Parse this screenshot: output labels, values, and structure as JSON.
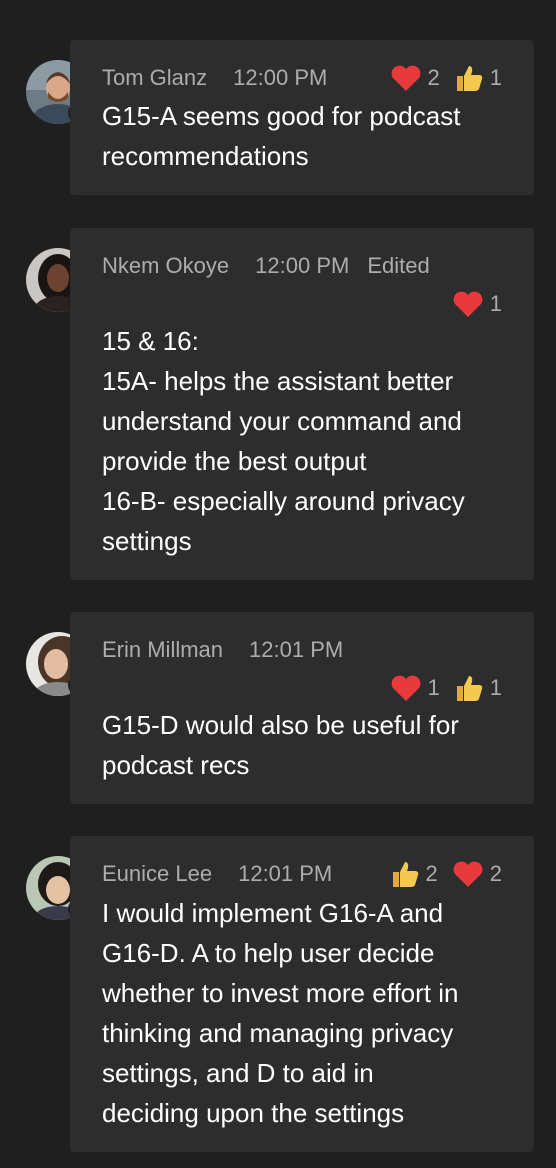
{
  "messages": [
    {
      "author": "Tom Glanz",
      "time": "12:00 PM",
      "edited": "",
      "status": "offline",
      "reactions": [
        {
          "icon": "heart-icon",
          "count": "2"
        },
        {
          "icon": "like-icon",
          "count": "1"
        }
      ],
      "lines": [
        "G15-A seems good for podcast",
        "recommendations"
      ]
    },
    {
      "author": "Nkem Okoye",
      "time": "12:00 PM",
      "edited": "Edited",
      "status": "offline",
      "reactions": [
        {
          "icon": "heart-icon",
          "count": "1"
        }
      ],
      "lines": [
        "15 & 16:",
        "15A- helps the assistant better",
        "understand your command and",
        "provide the best output",
        "16-B- especially around privacy",
        "settings"
      ]
    },
    {
      "author": "Erin Millman",
      "time": "12:01 PM",
      "edited": "",
      "status": "busy",
      "reactions": [
        {
          "icon": "heart-icon",
          "count": "1"
        },
        {
          "icon": "like-icon",
          "count": "1"
        }
      ],
      "lines": [
        "G15-D would also be useful for",
        "podcast recs"
      ]
    },
    {
      "author": "Eunice Lee",
      "time": "12:01 PM",
      "edited": "",
      "status": "busy",
      "reactions": [
        {
          "icon": "like-icon",
          "count": "2"
        },
        {
          "icon": "heart-icon",
          "count": "2"
        }
      ],
      "lines": [
        "I would implement G16-A and",
        "G16-D. A to help user decide",
        "whether to invest more effort in",
        "thinking and managing privacy",
        "settings, and D to aid in",
        "deciding upon the settings"
      ]
    }
  ],
  "colors": {
    "background": "#1f1f1f",
    "bubble": "#2d2d2d",
    "meta_text": "#adadad",
    "body_text": "#ffffff",
    "heart": "#e8393d",
    "like": "#f4c94f",
    "status": "#c4314b"
  }
}
